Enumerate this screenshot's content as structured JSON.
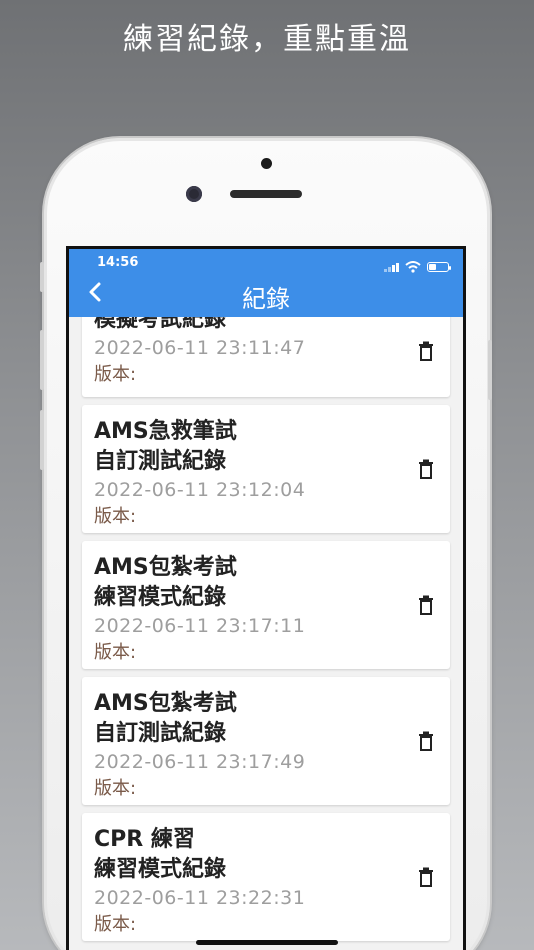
{
  "promo": {
    "headline": "練習紀錄，重點重溫"
  },
  "status_bar": {
    "time": "14:56"
  },
  "app_bar": {
    "title": "紀錄",
    "back_icon": "chevron-left-icon"
  },
  "records": [
    {
      "title_line1": "",
      "title_line2": "模擬考試紀錄",
      "date": "2022-06-11 23:11:47",
      "version": "版本:"
    },
    {
      "title_line1": "AMS急救筆試",
      "title_line2": "自訂測試紀錄",
      "date": "2022-06-11 23:12:04",
      "version": "版本:"
    },
    {
      "title_line1": "AMS包紮考試",
      "title_line2": "練習模式紀錄",
      "date": "2022-06-11 23:17:11",
      "version": "版本:"
    },
    {
      "title_line1": "AMS包紮考試",
      "title_line2": "自訂測試紀錄",
      "date": "2022-06-11 23:17:49",
      "version": "版本:"
    },
    {
      "title_line1": "CPR 練習",
      "title_line2": "練習模式紀錄",
      "date": "2022-06-11 23:22:31",
      "version": "版本:"
    }
  ],
  "colors": {
    "app_bar": "#3d8ee8",
    "version_text": "#7a5a49",
    "date_text": "#9e9e9e"
  }
}
